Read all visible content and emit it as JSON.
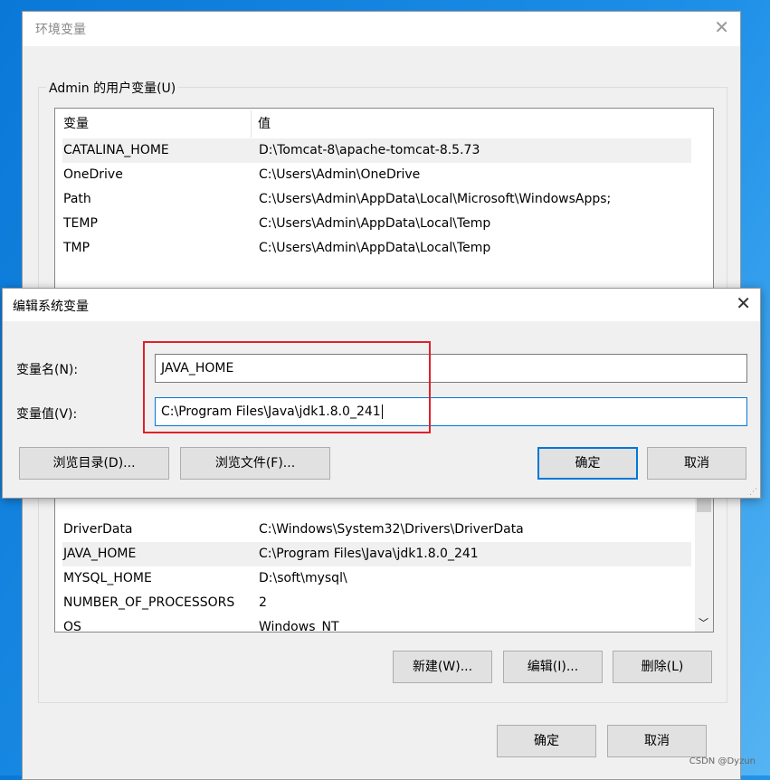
{
  "env_dialog": {
    "title": "环境变量",
    "close_icon": "close-icon",
    "user_group": {
      "label": "Admin 的用户变量(U)",
      "headers": [
        "变量",
        "值"
      ],
      "rows": [
        [
          "CATALINA_HOME",
          "D:\\Tomcat-8\\apache-tomcat-8.5.73"
        ],
        [
          "OneDrive",
          "C:\\Users\\Admin\\OneDrive"
        ],
        [
          "Path",
          "C:\\Users\\Admin\\AppData\\Local\\Microsoft\\WindowsApps;"
        ],
        [
          "TEMP",
          "C:\\Users\\Admin\\AppData\\Local\\Temp"
        ],
        [
          "TMP",
          "C:\\Users\\Admin\\AppData\\Local\\Temp"
        ]
      ]
    },
    "system_rows": [
      [
        "DriverData",
        "C:\\Windows\\System32\\Drivers\\DriverData"
      ],
      [
        "JAVA_HOME",
        "C:\\Program Files\\Java\\jdk1.8.0_241"
      ],
      [
        "MYSQL_HOME",
        "D:\\soft\\mysql\\"
      ],
      [
        "NUMBER_OF_PROCESSORS",
        "2"
      ],
      [
        "OS",
        "Windows_NT"
      ]
    ],
    "buttons": {
      "new": "新建(W)...",
      "edit": "编辑(I)...",
      "delete": "删除(L)",
      "ok": "确定",
      "cancel": "取消"
    }
  },
  "edit_dialog": {
    "title": "编辑系统变量",
    "name_label": "变量名(N):",
    "name_value": "JAVA_HOME",
    "value_label": "变量值(V):",
    "value_value": "C:\\Program Files\\Java\\jdk1.8.0_241",
    "buttons": {
      "browse_dir": "浏览目录(D)...",
      "browse_file": "浏览文件(F)...",
      "ok": "确定",
      "cancel": "取消"
    },
    "highlight_color": "#e0202a"
  },
  "watermark": "CSDN @Dyzun"
}
